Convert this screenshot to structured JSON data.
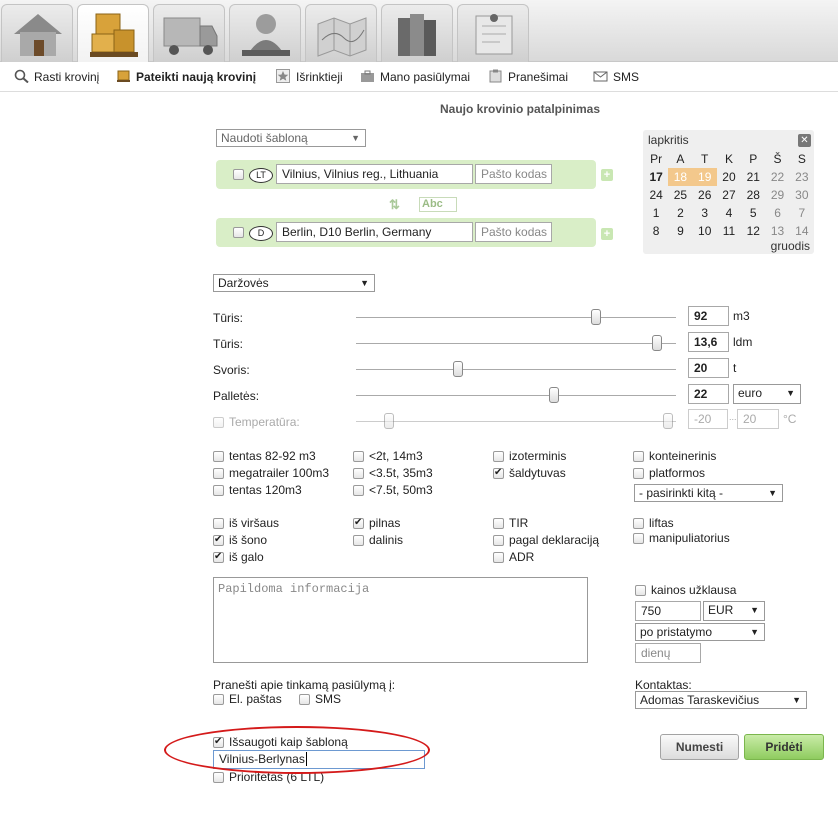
{
  "nav_tabs": [
    {
      "icon": "home-icon"
    },
    {
      "icon": "boxes-icon"
    },
    {
      "icon": "truck-icon"
    },
    {
      "icon": "person-writing-icon"
    },
    {
      "icon": "map-icon"
    },
    {
      "icon": "books-icon"
    },
    {
      "icon": "notice-board-icon"
    }
  ],
  "menu": {
    "find": "Rasti krovinį",
    "submit": "Pateikti naują krovinį",
    "favorites": "Išrinktieji",
    "offers": "Mano pasiūlymai",
    "notices": "Pranešimai",
    "sms": "SMS"
  },
  "page_title": "Naujo krovinio patalpinimas",
  "template_select": "Naudoti šabloną",
  "route": {
    "from": {
      "country": "LT",
      "address": "Vilnius, Vilnius reg.,  Lithuania",
      "postcode_placeholder": "Pašto kodas"
    },
    "to": {
      "country": "D",
      "address": "Berlin, D10 Berlin,  Germany",
      "postcode_placeholder": "Pašto kodas"
    },
    "swap_icon": "swap-arrows-icon",
    "abc_label": "Abc"
  },
  "calendar": {
    "month": "lapkritis",
    "next_month": "gruodis",
    "weekdays": [
      "Pr",
      "A",
      "T",
      "K",
      "P",
      "Š",
      "S"
    ],
    "weeks": [
      [
        "17",
        "18",
        "19",
        "20",
        "21",
        "22",
        "23"
      ],
      [
        "24",
        "25",
        "26",
        "27",
        "28",
        "29",
        "30"
      ],
      [
        "1",
        "2",
        "3",
        "4",
        "5",
        "6",
        "7"
      ],
      [
        "8",
        "9",
        "10",
        "11",
        "12",
        "13",
        "14"
      ]
    ]
  },
  "cargo_type": "Daržovės",
  "sliders": [
    {
      "label": "Tūris:",
      "value": "92",
      "unit": "m3",
      "level": 0.75
    },
    {
      "label": "Tūris:",
      "value": "13,6",
      "unit": "ldm",
      "level": 0.94
    },
    {
      "label": "Svoris:",
      "value": "20",
      "unit": "t",
      "level": 0.32
    },
    {
      "label": "Palletės:",
      "value": "22",
      "unit": "euro",
      "level": 0.62
    }
  ],
  "temperature": {
    "label": "Temperatūra:",
    "min": "-20",
    "max": "20",
    "unit": "°C",
    "sep": "..."
  },
  "vehicle_options": {
    "col1": [
      {
        "label": "tentas 82-92 m3",
        "checked": false
      },
      {
        "label": "megatrailer 100m3",
        "checked": false
      },
      {
        "label": "tentas 120m3",
        "checked": false
      }
    ],
    "col2": [
      {
        "label": "<2t, 14m3",
        "checked": false
      },
      {
        "label": "<3.5t, 35m3",
        "checked": false
      },
      {
        "label": "<7.5t, 50m3",
        "checked": false
      }
    ],
    "col3": [
      {
        "label": "izoterminis",
        "checked": false
      },
      {
        "label": "šaldytuvas",
        "checked": true
      }
    ],
    "col4": [
      {
        "label": "konteinerinis",
        "checked": false
      },
      {
        "label": "platformos",
        "checked": false
      }
    ],
    "other_select": "- pasirinkti kitą -"
  },
  "loading_options": {
    "col1": [
      {
        "label": "iš viršaus",
        "checked": false
      },
      {
        "label": "iš šono",
        "checked": true
      },
      {
        "label": "iš galo",
        "checked": true
      }
    ],
    "col2": [
      {
        "label": "pilnas",
        "checked": true
      },
      {
        "label": "dalinis",
        "checked": false
      }
    ],
    "col3": [
      {
        "label": "TIR",
        "checked": false
      },
      {
        "label": "pagal deklaraciją",
        "checked": false
      },
      {
        "label": "ADR",
        "checked": false
      }
    ],
    "col4": [
      {
        "label": "liftas",
        "checked": false
      },
      {
        "label": "manipuliatorius",
        "checked": false
      }
    ]
  },
  "additional_info_placeholder": "Papildoma informacija",
  "price": {
    "request_label": "kainos užklausa",
    "amount": "750",
    "currency": "EUR",
    "payment_terms": "po pristatymo",
    "days_placeholder": "dienų"
  },
  "notify": {
    "label": "Pranešti apie tinkamą pasiūlymą į:",
    "email": "El. paštas",
    "sms": "SMS"
  },
  "contacts": {
    "label": "Kontaktas:",
    "value": "Adomas Taraskevičius"
  },
  "save_template": {
    "label": "Išsaugoti kaip šabloną",
    "checked": true,
    "name": "Vilnius-Berlynas"
  },
  "priority": {
    "label": "Prioritetas (6 LTL)"
  },
  "buttons": {
    "cancel": "Numesti",
    "submit": "Pridėti"
  },
  "colors": {
    "route_bg": "#d9eec7",
    "highlight_day": "#f3c88c",
    "annotation": "#d41a1a",
    "submit_btn": "#8fcc5f"
  }
}
